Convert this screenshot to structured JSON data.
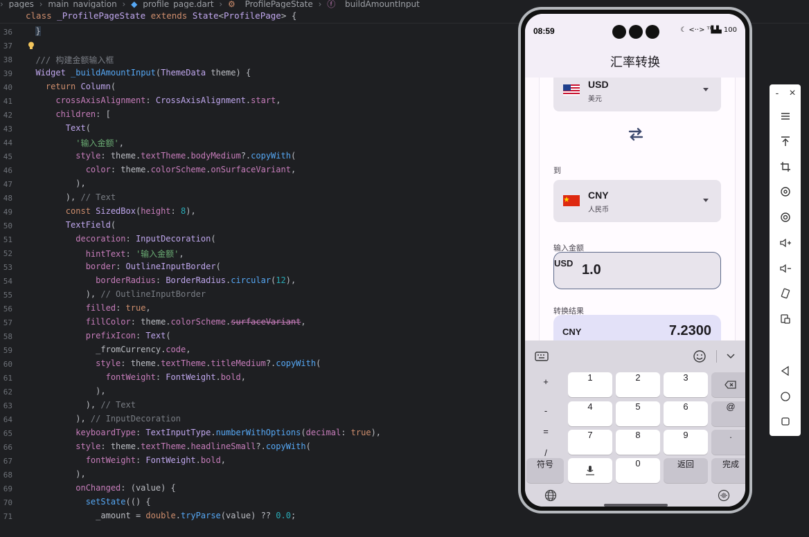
{
  "editor": {
    "breadcrumb": [
      "pages",
      "main_navigation",
      "profile_page.dart",
      "_ProfilePageState",
      "_buildAmountInput"
    ],
    "sticky_header": "class _ProfilePageState extends State<ProfilePage> {",
    "line_numbers": [
      "36",
      "37",
      "38",
      "39",
      "40",
      "41",
      "42",
      "43",
      "44",
      "45",
      "46",
      "47",
      "48",
      "49",
      "50",
      "51",
      "52",
      "53",
      "54",
      "55",
      "56",
      "57",
      "58",
      "59",
      "60",
      "61",
      "62",
      "63",
      "64",
      "65",
      "66",
      "67",
      "68",
      "69",
      "70",
      "71"
    ]
  },
  "phone": {
    "status": {
      "time": "08:59",
      "icons": "☾ <··> ᵀᴵ▙▙ 100"
    },
    "title": "汇率转换",
    "from": {
      "code": "USD",
      "name": "美元"
    },
    "to_label": "到",
    "to": {
      "code": "CNY",
      "name": "人民币"
    },
    "amount_label": "输入金额",
    "amount": {
      "prefix": "USD",
      "value": "1.0"
    },
    "result_label": "转换结果",
    "result": {
      "code": "CNY",
      "value": "7.2300"
    },
    "keyboard": {
      "symbols": [
        "+",
        "-",
        "=",
        "/"
      ],
      "rows": [
        [
          "1",
          "2",
          "3"
        ],
        [
          "4",
          "5",
          "6"
        ],
        [
          "7",
          "8",
          "9"
        ]
      ],
      "right": [
        "⌫",
        "@",
        "."
      ],
      "bottom": {
        "sym": "符号",
        "zero": "0",
        "back": "返回",
        "done": "完成"
      }
    }
  },
  "side_toolbar": {
    "minimize": "-",
    "close": "×"
  }
}
